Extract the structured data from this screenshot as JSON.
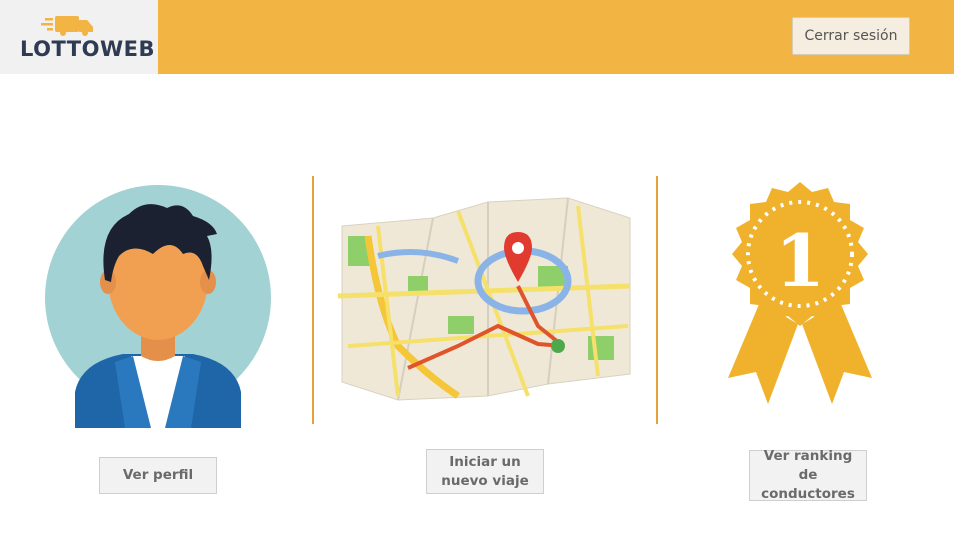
{
  "header": {
    "logo_text": "LOTTOWEB",
    "logout_label": "Cerrar sesión",
    "bg_color": "#f2b442"
  },
  "cards": [
    {
      "icon": "user-profile-icon",
      "button_label": "Ver perfil"
    },
    {
      "icon": "map-pin-icon",
      "button_label": "Iniciar un nuevo viaje"
    },
    {
      "icon": "first-place-ribbon-icon",
      "button_label": "Ver ranking de conductores"
    }
  ],
  "ribbon_number": "1"
}
